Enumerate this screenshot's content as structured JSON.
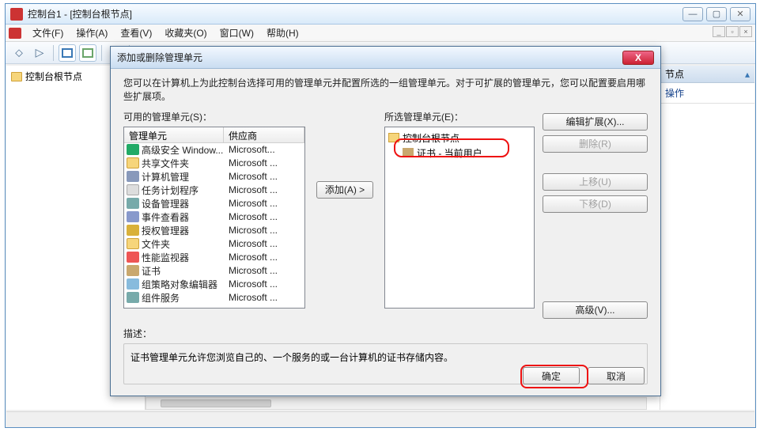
{
  "window": {
    "title": "控制台1 - [控制台根节点]"
  },
  "menu": {
    "file": "文件(F)",
    "action": "操作(A)",
    "view": "查看(V)",
    "favorites": "收藏夹(O)",
    "window": "窗口(W)",
    "help": "帮助(H)"
  },
  "tree": {
    "root": "控制台根节点"
  },
  "actions": {
    "pane_suffix": "节点",
    "sub_suffix": "操作"
  },
  "dialog": {
    "title": "添加或删除管理单元",
    "intro": "您可以在计算机上为此控制台选择可用的管理单元并配置所选的一组管理单元。对于可扩展的管理单元，您可以配置要启用哪些扩展项。",
    "available_label": "可用的管理单元(S)：",
    "selected_label": "所选管理单元(E)：",
    "col_snapin": "管理单元",
    "col_vendor": "供应商",
    "add_btn": "添加(A) >",
    "edit_ext_btn": "编辑扩展(X)...",
    "remove_btn": "删除(R)",
    "moveup_btn": "上移(U)",
    "movedown_btn": "下移(D)",
    "advanced_btn": "高级(V)...",
    "desc_label": "描述：",
    "desc_text": "证书管理单元允许您浏览自己的、一个服务的或一台计算机的证书存储内容。",
    "ok": "确定",
    "cancel": "取消",
    "root_node": "控制台根节点",
    "cert_node": "证书 - 当前用户",
    "snapins": [
      {
        "name": "高级安全 Window...",
        "vendor": "Microsoft...",
        "ic": "ic-shield"
      },
      {
        "name": "共享文件夹",
        "vendor": "Microsoft ...",
        "ic": "ic-fold"
      },
      {
        "name": "计算机管理",
        "vendor": "Microsoft ...",
        "ic": "ic-pc"
      },
      {
        "name": "任务计划程序",
        "vendor": "Microsoft ...",
        "ic": "ic-clock"
      },
      {
        "name": "设备管理器",
        "vendor": "Microsoft ...",
        "ic": "ic-dev"
      },
      {
        "name": "事件查看器",
        "vendor": "Microsoft ...",
        "ic": "ic-ev"
      },
      {
        "name": "授权管理器",
        "vendor": "Microsoft ...",
        "ic": "ic-auth"
      },
      {
        "name": "文件夹",
        "vendor": "Microsoft ...",
        "ic": "ic-fold"
      },
      {
        "name": "性能监视器",
        "vendor": "Microsoft ...",
        "ic": "ic-perf"
      },
      {
        "name": "证书",
        "vendor": "Microsoft ...",
        "ic": "ic-cert"
      },
      {
        "name": "组策略对象编辑器",
        "vendor": "Microsoft ...",
        "ic": "ic-gp"
      },
      {
        "name": "组件服务",
        "vendor": "Microsoft ...",
        "ic": "ic-dev"
      }
    ]
  }
}
